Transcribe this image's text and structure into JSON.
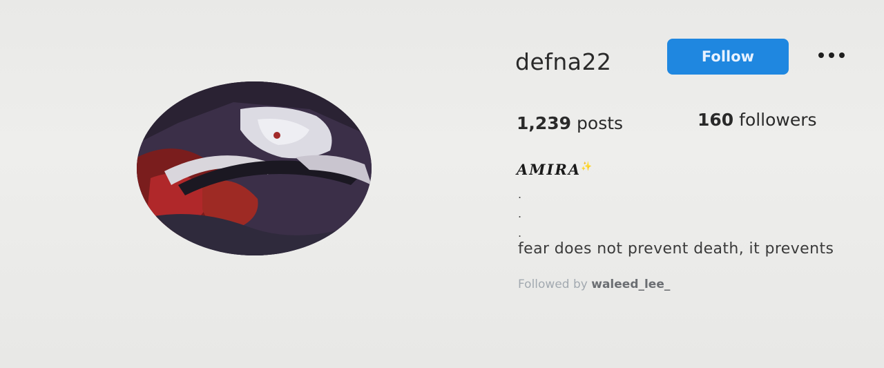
{
  "profile": {
    "username": "defna22",
    "follow_label": "Follow",
    "more_icon": "more-horizontal-icon",
    "avatar_icon": "profile-picture",
    "stats": {
      "posts_count": "1,239",
      "posts_label": "posts",
      "followers_count": "160",
      "followers_label": "followers"
    },
    "full_name": "AMIRA",
    "full_name_sparkle": "✨",
    "bio_lines": [
      ".",
      ".",
      "."
    ],
    "bio_text": "fear does not prevent death, it prevents",
    "followed_by_prefix": "Followed by",
    "followed_by_user": "waleed_lee_"
  },
  "colors": {
    "follow_button": "#1f87e0",
    "background": "#ececec",
    "text": "#262626"
  }
}
